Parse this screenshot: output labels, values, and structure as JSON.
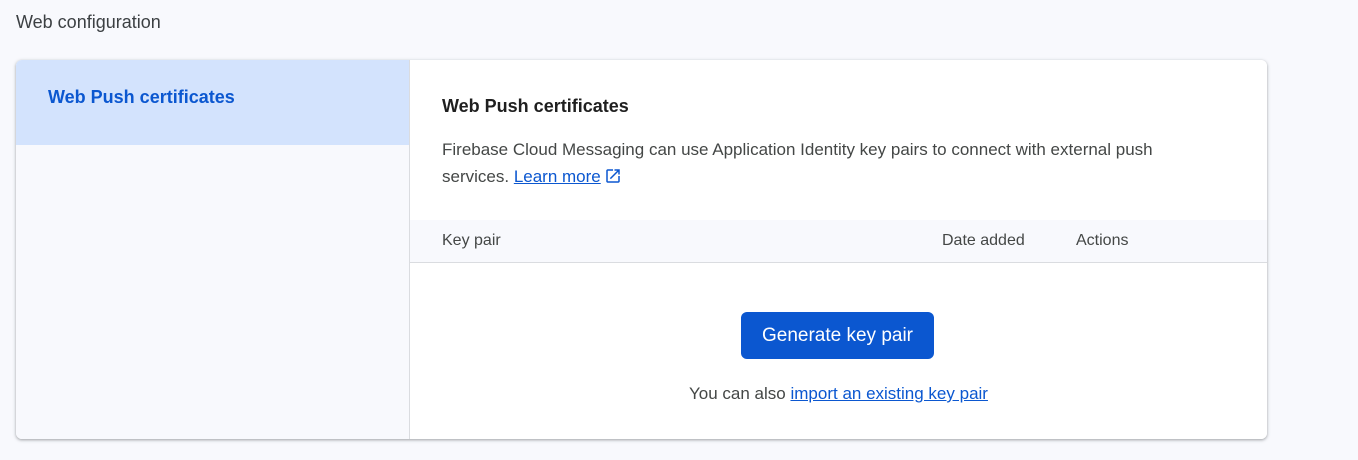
{
  "page": {
    "title": "Web configuration"
  },
  "sidebar": {
    "items": [
      {
        "label": "Web Push certificates",
        "selected": true
      }
    ]
  },
  "main": {
    "title": "Web Push certificates",
    "description": "Firebase Cloud Messaging can use Application Identity key pairs to connect with external push services.",
    "learn_more_label": "Learn more",
    "learn_more_icon": "open-in-new-icon",
    "table": {
      "columns": [
        "Key pair",
        "Date added",
        "Actions"
      ],
      "rows": []
    },
    "generate_button_label": "Generate key pair",
    "import_prefix": "You can also",
    "import_link_label": "import an existing key pair"
  },
  "colors": {
    "accent": "#0b57d0",
    "selected_bg": "#d3e3fd",
    "background": "#f8f9fd"
  }
}
